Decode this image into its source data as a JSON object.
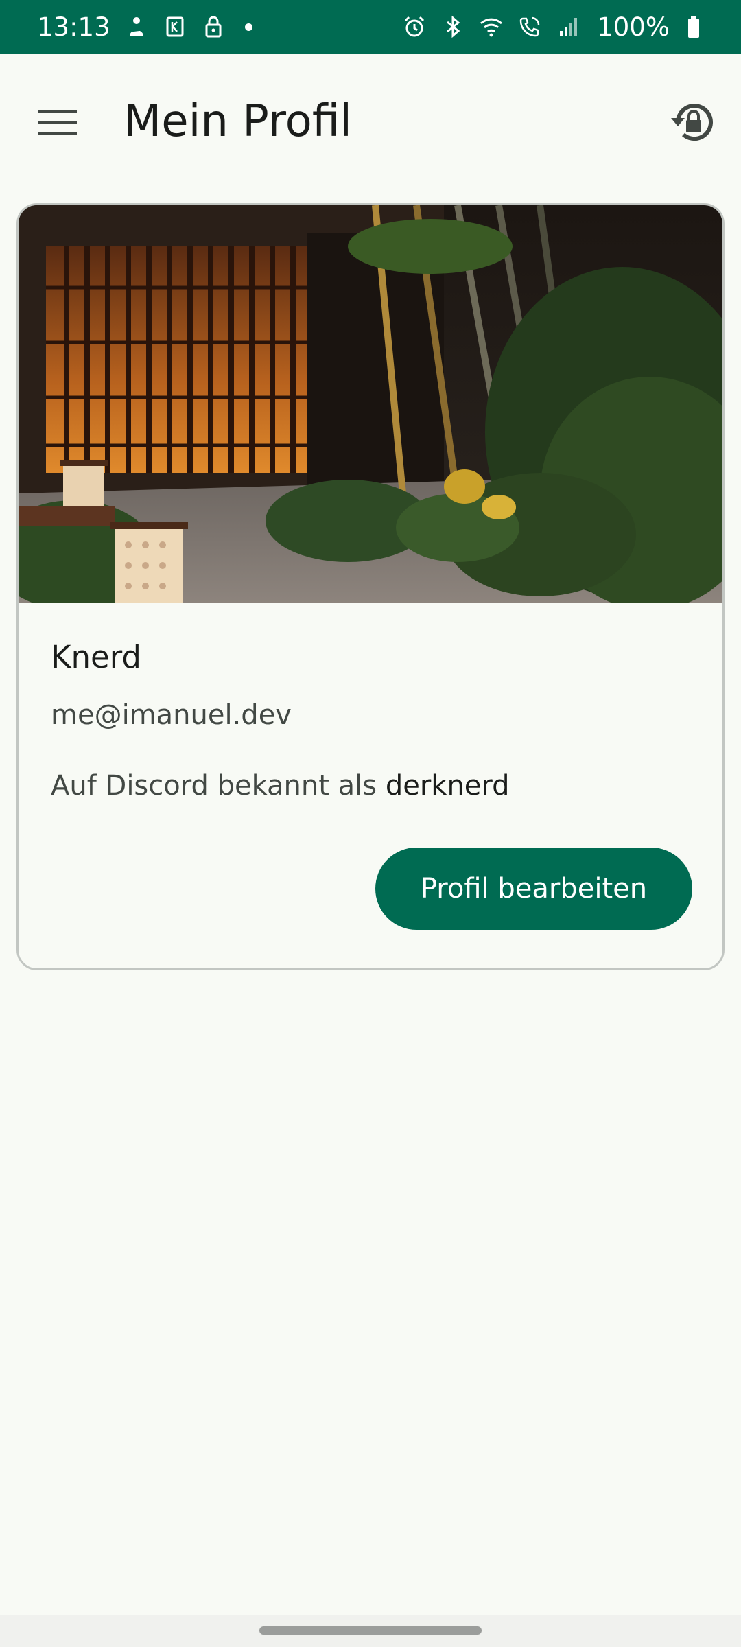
{
  "status_bar": {
    "time": "13:13",
    "battery": "100%",
    "icons_left": [
      "notification-person-icon",
      "notification-k-icon",
      "lock-icon"
    ],
    "icons_right": [
      "alarm-icon",
      "bluetooth-icon",
      "wifi-icon",
      "wifi-calling-icon",
      "signal-icon",
      "battery-icon"
    ]
  },
  "app_bar": {
    "title": "Mein Profil",
    "menu_icon": "menu-icon",
    "action_icon": "lock-reset-icon"
  },
  "profile_card": {
    "name": "Knerd",
    "email": "me@imanuel.dev",
    "discord_prefix": "Auf Discord bekannt als",
    "discord_name": "derknerd",
    "edit_button": "Profil bearbeiten",
    "image": "japanese-garden-banner"
  },
  "colors": {
    "primary": "#006b52",
    "background": "#f8faf5",
    "on_primary": "#ffffff"
  }
}
